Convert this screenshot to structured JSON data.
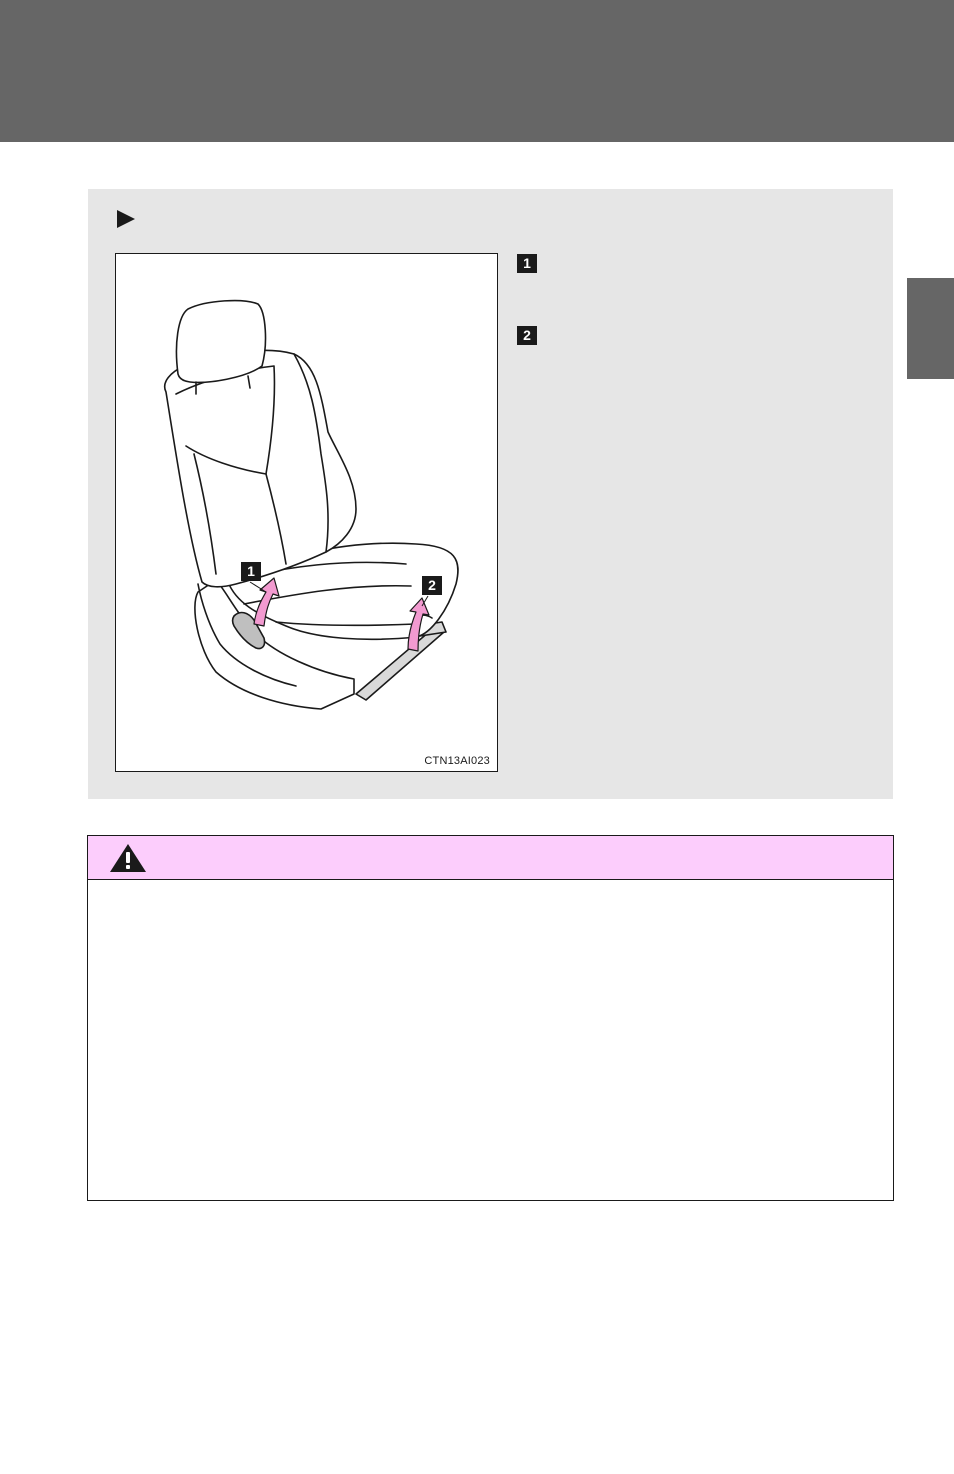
{
  "figure": {
    "code": "CTN13AI023",
    "callouts": [
      "1",
      "2"
    ]
  },
  "side_list": {
    "items": [
      "1",
      "2"
    ]
  },
  "colors": {
    "header_gray": "#666666",
    "panel_gray": "#e6e6e6",
    "warning_pink": "#fccdfc",
    "arrow_pink": "#f29ad0"
  },
  "icons": {
    "panel_marker": "triangle-right-icon",
    "warning": "warning-triangle-icon"
  }
}
